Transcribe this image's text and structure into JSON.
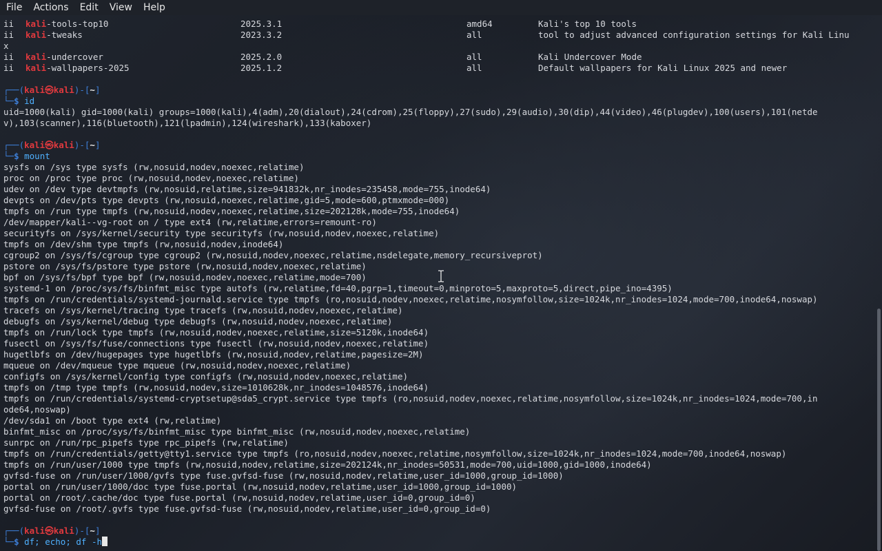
{
  "menu": [
    "File",
    "Actions",
    "Edit",
    "View",
    "Help"
  ],
  "packages": [
    {
      "st": "ii",
      "name_hl": "kali",
      "name_rest": "-tools-top10",
      "ver": "2025.3.1",
      "arch": "amd64",
      "desc": "Kali's top 10 tools"
    },
    {
      "st": "ii",
      "name_hl": "kali",
      "name_rest": "-tweaks",
      "ver": "2023.3.2",
      "arch": "all",
      "desc": "tool to adjust advanced configuration settings for Kali Linu"
    },
    {
      "st": "x",
      "name_hl": "",
      "name_rest": "",
      "ver": "",
      "arch": "",
      "desc": ""
    },
    {
      "st": "ii",
      "name_hl": "kali",
      "name_rest": "-undercover",
      "ver": "2025.2.0",
      "arch": "all",
      "desc": "Kali Undercover Mode"
    },
    {
      "st": "ii",
      "name_hl": "kali",
      "name_rest": "-wallpapers-2025",
      "ver": "2025.1.2",
      "arch": "all",
      "desc": "Default wallpapers for Kali Linux 2025 and newer"
    }
  ],
  "prompt": {
    "user": "kali",
    "at": "㉿",
    "host": "kali",
    "dir": "~"
  },
  "cmd_id": "id",
  "id_output": [
    "uid=1000(kali) gid=1000(kali) groups=1000(kali),4(adm),20(dialout),24(cdrom),25(floppy),27(sudo),29(audio),30(dip),44(video),46(plugdev),100(users),101(netde",
    "v),103(scanner),116(bluetooth),121(lpadmin),124(wireshark),133(kaboxer)"
  ],
  "cmd_mount": "mount",
  "mount_output": [
    "sysfs on /sys type sysfs (rw,nosuid,nodev,noexec,relatime)",
    "proc on /proc type proc (rw,nosuid,nodev,noexec,relatime)",
    "udev on /dev type devtmpfs (rw,nosuid,relatime,size=941832k,nr_inodes=235458,mode=755,inode64)",
    "devpts on /dev/pts type devpts (rw,nosuid,noexec,relatime,gid=5,mode=600,ptmxmode=000)",
    "tmpfs on /run type tmpfs (rw,nosuid,nodev,noexec,relatime,size=202128k,mode=755,inode64)",
    "/dev/mapper/kali--vg-root on / type ext4 (rw,relatime,errors=remount-ro)",
    "securityfs on /sys/kernel/security type securityfs (rw,nosuid,nodev,noexec,relatime)",
    "tmpfs on /dev/shm type tmpfs (rw,nosuid,nodev,inode64)",
    "cgroup2 on /sys/fs/cgroup type cgroup2 (rw,nosuid,nodev,noexec,relatime,nsdelegate,memory_recursiveprot)",
    "pstore on /sys/fs/pstore type pstore (rw,nosuid,nodev,noexec,relatime)",
    "bpf on /sys/fs/bpf type bpf (rw,nosuid,nodev,noexec,relatime,mode=700)",
    "systemd-1 on /proc/sys/fs/binfmt_misc type autofs (rw,relatime,fd=40,pgrp=1,timeout=0,minproto=5,maxproto=5,direct,pipe_ino=4395)",
    "tmpfs on /run/credentials/systemd-journald.service type tmpfs (ro,nosuid,nodev,noexec,relatime,nosymfollow,size=1024k,nr_inodes=1024,mode=700,inode64,noswap)",
    "tracefs on /sys/kernel/tracing type tracefs (rw,nosuid,nodev,noexec,relatime)",
    "debugfs on /sys/kernel/debug type debugfs (rw,nosuid,nodev,noexec,relatime)",
    "tmpfs on /run/lock type tmpfs (rw,nosuid,nodev,noexec,relatime,size=5120k,inode64)",
    "fusectl on /sys/fs/fuse/connections type fusectl (rw,nosuid,nodev,noexec,relatime)",
    "hugetlbfs on /dev/hugepages type hugetlbfs (rw,nosuid,nodev,relatime,pagesize=2M)",
    "mqueue on /dev/mqueue type mqueue (rw,nosuid,nodev,noexec,relatime)",
    "configfs on /sys/kernel/config type configfs (rw,nosuid,nodev,noexec,relatime)",
    "tmpfs on /tmp type tmpfs (rw,nosuid,nodev,size=1010628k,nr_inodes=1048576,inode64)",
    "tmpfs on /run/credentials/systemd-cryptsetup@sda5_crypt.service type tmpfs (ro,nosuid,nodev,noexec,relatime,nosymfollow,size=1024k,nr_inodes=1024,mode=700,in",
    "ode64,noswap)",
    "/dev/sda1 on /boot type ext4 (rw,relatime)",
    "binfmt_misc on /proc/sys/fs/binfmt_misc type binfmt_misc (rw,nosuid,nodev,noexec,relatime)",
    "sunrpc on /run/rpc_pipefs type rpc_pipefs (rw,relatime)",
    "tmpfs on /run/credentials/getty@tty1.service type tmpfs (ro,nosuid,nodev,noexec,relatime,nosymfollow,size=1024k,nr_inodes=1024,mode=700,inode64,noswap)",
    "tmpfs on /run/user/1000 type tmpfs (rw,nosuid,nodev,relatime,size=202124k,nr_inodes=50531,mode=700,uid=1000,gid=1000,inode64)",
    "gvfsd-fuse on /run/user/1000/gvfs type fuse.gvfsd-fuse (rw,nosuid,nodev,relatime,user_id=1000,group_id=1000)",
    "portal on /run/user/1000/doc type fuse.portal (rw,nosuid,nodev,relatime,user_id=1000,group_id=1000)",
    "portal on /root/.cache/doc type fuse.portal (rw,nosuid,nodev,relatime,user_id=0,group_id=0)",
    "gvfsd-fuse on /root/.gvfs type fuse.gvfsd-fuse (rw,nosuid,nodev,relatime,user_id=0,group_id=0)"
  ],
  "cmd_current": "df; echo; df -h",
  "colors": {
    "prompt_frame": "#3d7fd8",
    "user_host": "#e0393e",
    "command": "#4fb1ff",
    "text": "#d7d9de",
    "bg": "#1b1f27"
  }
}
